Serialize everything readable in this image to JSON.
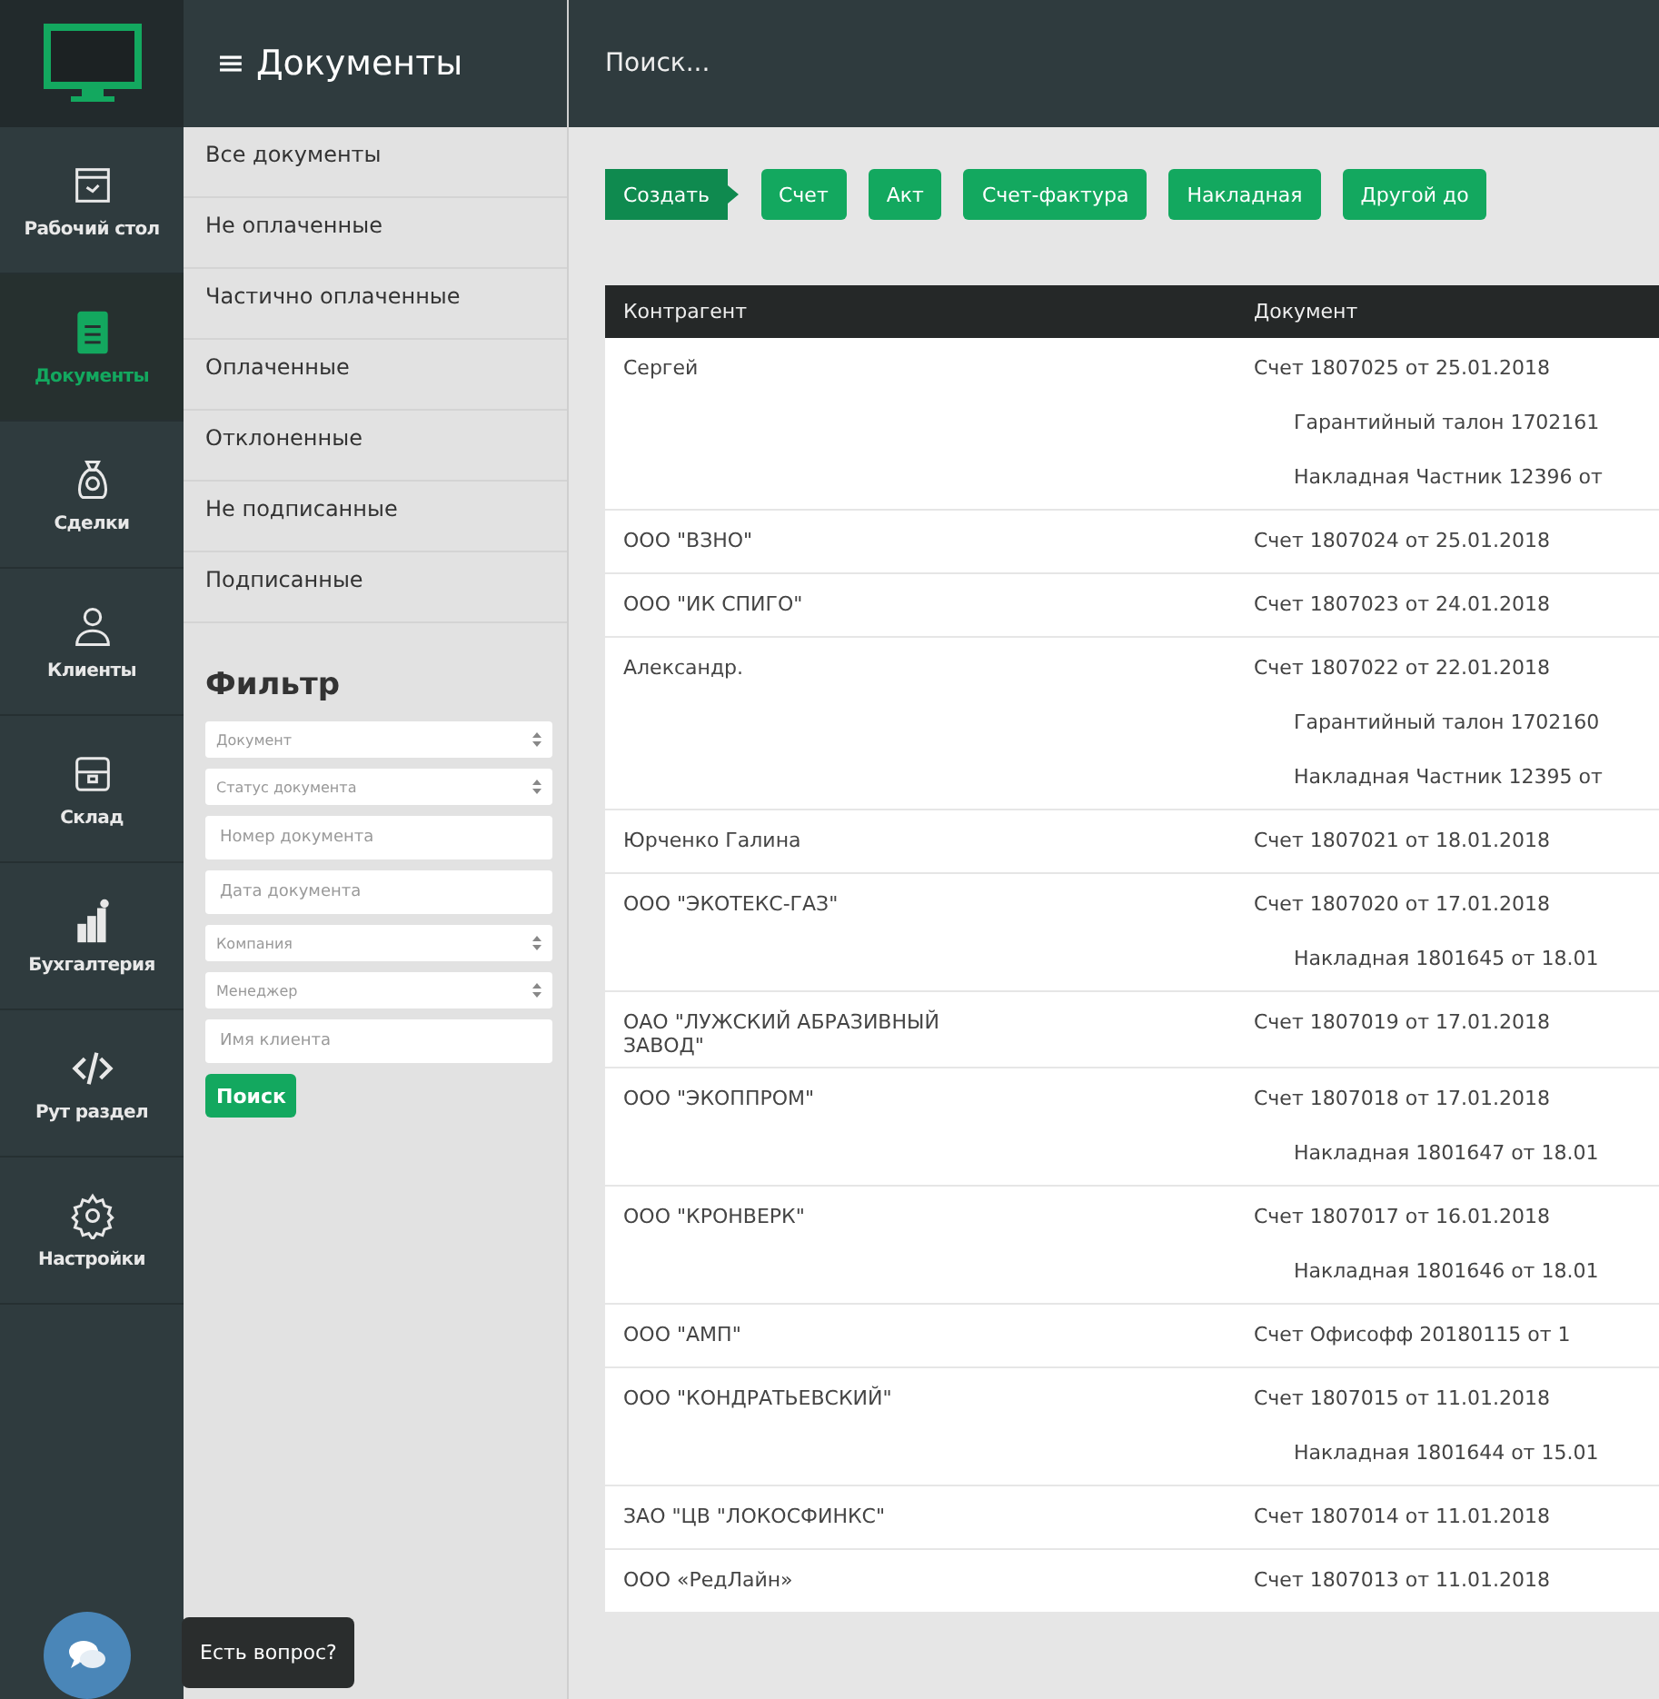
{
  "nav": {
    "items": [
      {
        "label": "Рабочий стол",
        "selected": false
      },
      {
        "label": "Документы",
        "selected": true
      },
      {
        "label": "Сделки",
        "selected": false
      },
      {
        "label": "Клиенты",
        "selected": false
      },
      {
        "label": "Склад",
        "selected": false
      },
      {
        "label": "Бухгалтерия",
        "selected": false
      },
      {
        "label": "Рут раздел",
        "selected": false
      },
      {
        "label": "Настройки",
        "selected": false
      }
    ]
  },
  "submenu": {
    "title": "≡ Документы",
    "items": [
      "Все документы",
      "Не оплаченные",
      "Частично оплаченные",
      "Оплаченные",
      "Отклоненные",
      "Не подписанные",
      "Подписанные"
    ]
  },
  "filter": {
    "title": "Фильтр",
    "fields": [
      {
        "kind": "select",
        "placeholder": "Документ"
      },
      {
        "kind": "select",
        "placeholder": "Статус документа"
      },
      {
        "kind": "input",
        "placeholder": "Номер документа"
      },
      {
        "kind": "input",
        "placeholder": "Дата документа"
      },
      {
        "kind": "select",
        "placeholder": "Компания"
      },
      {
        "kind": "select",
        "placeholder": "Менеджер"
      },
      {
        "kind": "input",
        "placeholder": "Имя клиента"
      }
    ],
    "button": "Поиск"
  },
  "search": {
    "placeholder": "Поиск..."
  },
  "create": {
    "label": "Создать",
    "buttons": [
      "Счет",
      "Акт",
      "Счет-фактура",
      "Накладная",
      "Другой до"
    ]
  },
  "table": {
    "columns": [
      "Контрагент",
      "Документ"
    ],
    "rows": [
      {
        "counterparty": "Сергей",
        "documents": [
          {
            "text": "Счет 1807025 от 25.01.2018",
            "children": [
              {
                "text": "Гарантийный талон 1702161"
              },
              {
                "text": "Накладная Частник 12396 от"
              }
            ]
          }
        ]
      },
      {
        "counterparty": "ООО \"ВЗНО\"",
        "documents": [
          {
            "text": "Счет 1807024 от 25.01.2018"
          }
        ]
      },
      {
        "counterparty": "ООО \"ИК СПИГО\"",
        "documents": [
          {
            "text": "Счет 1807023 от 24.01.2018"
          }
        ]
      },
      {
        "counterparty": "Александр.",
        "documents": [
          {
            "text": "Счет 1807022 от 22.01.2018",
            "children": [
              {
                "text": "Гарантийный талон 1702160"
              },
              {
                "text": "Накладная Частник 12395 от"
              }
            ]
          }
        ]
      },
      {
        "counterparty": "Юрченко Галина",
        "documents": [
          {
            "text": "Счет 1807021 от 18.01.2018"
          }
        ]
      },
      {
        "counterparty": "ООО \"ЭКОТЕКС-ГАЗ\"",
        "documents": [
          {
            "text": "Счет 1807020 от 17.01.2018",
            "children": [
              {
                "text": "Накладная 1801645 от 18.01"
              }
            ]
          }
        ]
      },
      {
        "counterparty": "ОАО \"ЛУЖСКИЙ АБРАЗИВНЫЙ ЗАВОД\"",
        "documents": [
          {
            "text": "Счет 1807019 от 17.01.2018"
          }
        ]
      },
      {
        "counterparty": "ООО \"ЭКОППРОМ\"",
        "documents": [
          {
            "text": "Счет 1807018 от 17.01.2018",
            "children": [
              {
                "text": "Накладная 1801647 от 18.01"
              }
            ]
          }
        ]
      },
      {
        "counterparty": "ООО \"КРОНВЕРК\"",
        "documents": [
          {
            "text": "Счет 1807017 от 16.01.2018",
            "children": [
              {
                "text": "Накладная 1801646 от 18.01"
              }
            ]
          }
        ]
      },
      {
        "counterparty": "ООО \"АМП\"",
        "documents": [
          {
            "text": "Счет Офисофф 20180115 от 1"
          }
        ]
      },
      {
        "counterparty": "ООО \"КОНДРАТЬЕВСКИЙ\"",
        "documents": [
          {
            "text": "Счет 1807015 от 11.01.2018",
            "children": [
              {
                "text": "Накладная 1801644 от 15.01"
              }
            ]
          }
        ]
      },
      {
        "counterparty": "ЗАО \"ЦВ \"ЛОКОСФИНКС\"",
        "documents": [
          {
            "text": "Счет 1807014 от 11.01.2018"
          }
        ]
      },
      {
        "counterparty": "ООО «РедЛайн»",
        "documents": [
          {
            "text": "Счет 1807013 от 11.01.2018"
          }
        ]
      }
    ]
  },
  "chat": {
    "tooltip": "Есть вопрос?"
  }
}
